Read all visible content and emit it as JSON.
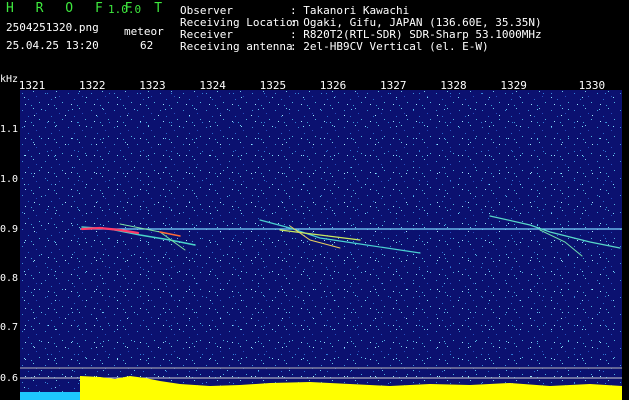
{
  "app": {
    "brand": "H R O F F T",
    "version": "1.0.0"
  },
  "file": {
    "filename": "2504251320.png",
    "timestamp": "25.04.25 13:20"
  },
  "counter": {
    "label": "meteor",
    "value": "62"
  },
  "station": {
    "rows": [
      {
        "label": "Observer",
        "value": ": Takanori Kawachi"
      },
      {
        "label": "Receiving Location",
        "value": ": Ogaki, Gifu, JAPAN (136.60E, 35.35N)"
      },
      {
        "label": "Receiver",
        "value": ": R820T2(RTL-SDR) SDR-Sharp 53.1000MHz"
      },
      {
        "label": "Receiving antenna",
        "value": ": 2el-HB9CV Vertical (el. E-W)"
      }
    ]
  },
  "axes": {
    "y_unit": "kHz",
    "y_ticks": [
      "1.1",
      "1.0",
      "0.9",
      "0.8",
      "0.7",
      "0.6"
    ],
    "x_ticks": [
      "1321",
      "1322",
      "1323",
      "1324",
      "1325",
      "1326",
      "1327",
      "1328",
      "1329",
      "1330"
    ]
  },
  "colors": {
    "background": "#000000",
    "waterfall_bg": "#0b1170",
    "header_green": "#3ee83e",
    "signal_line": "#7ad7ff",
    "bottom_band": "#ffff00"
  }
}
